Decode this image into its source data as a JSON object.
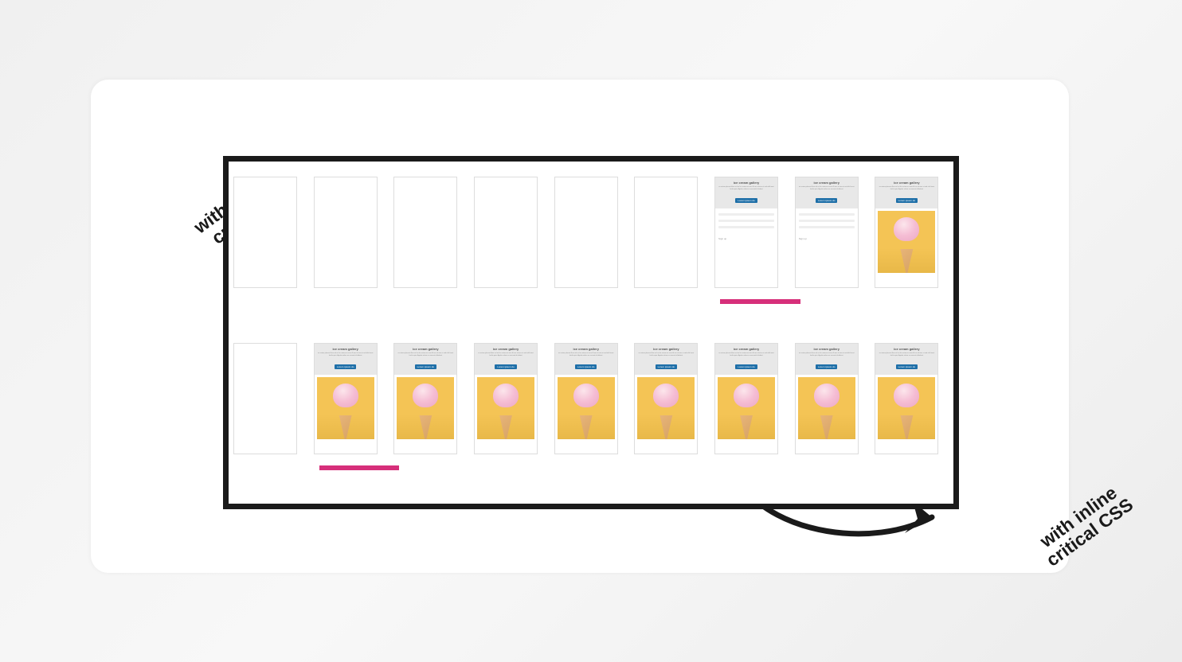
{
  "labels": {
    "without": "without inline\ncritical CSS",
    "with": "with inline\ncritical CSS"
  },
  "frame_content": {
    "title": "ice cream gallery",
    "desc": "ex autem placeat illum vel mi hic autem mi vero illi nec id eius et sed nihil inest facilis quia. Agnitio solore ex aversati id debest",
    "button": "Lorem ipsum do",
    "form_caption": "Sign up"
  },
  "rows": {
    "top": [
      {
        "type": "empty"
      },
      {
        "type": "empty"
      },
      {
        "type": "empty"
      },
      {
        "type": "empty"
      },
      {
        "type": "empty"
      },
      {
        "type": "empty"
      },
      {
        "type": "header-form",
        "selected": true
      },
      {
        "type": "header-form"
      },
      {
        "type": "full"
      }
    ],
    "bottom": [
      {
        "type": "empty"
      },
      {
        "type": "full",
        "selected": true
      },
      {
        "type": "full"
      },
      {
        "type": "full"
      },
      {
        "type": "full"
      },
      {
        "type": "full"
      },
      {
        "type": "full"
      },
      {
        "type": "full"
      },
      {
        "type": "full"
      }
    ]
  },
  "colors": {
    "border": "#1a1a1a",
    "select": "#d62f7a",
    "button": "#1e6fa8",
    "image_bg": "#f4c455"
  }
}
